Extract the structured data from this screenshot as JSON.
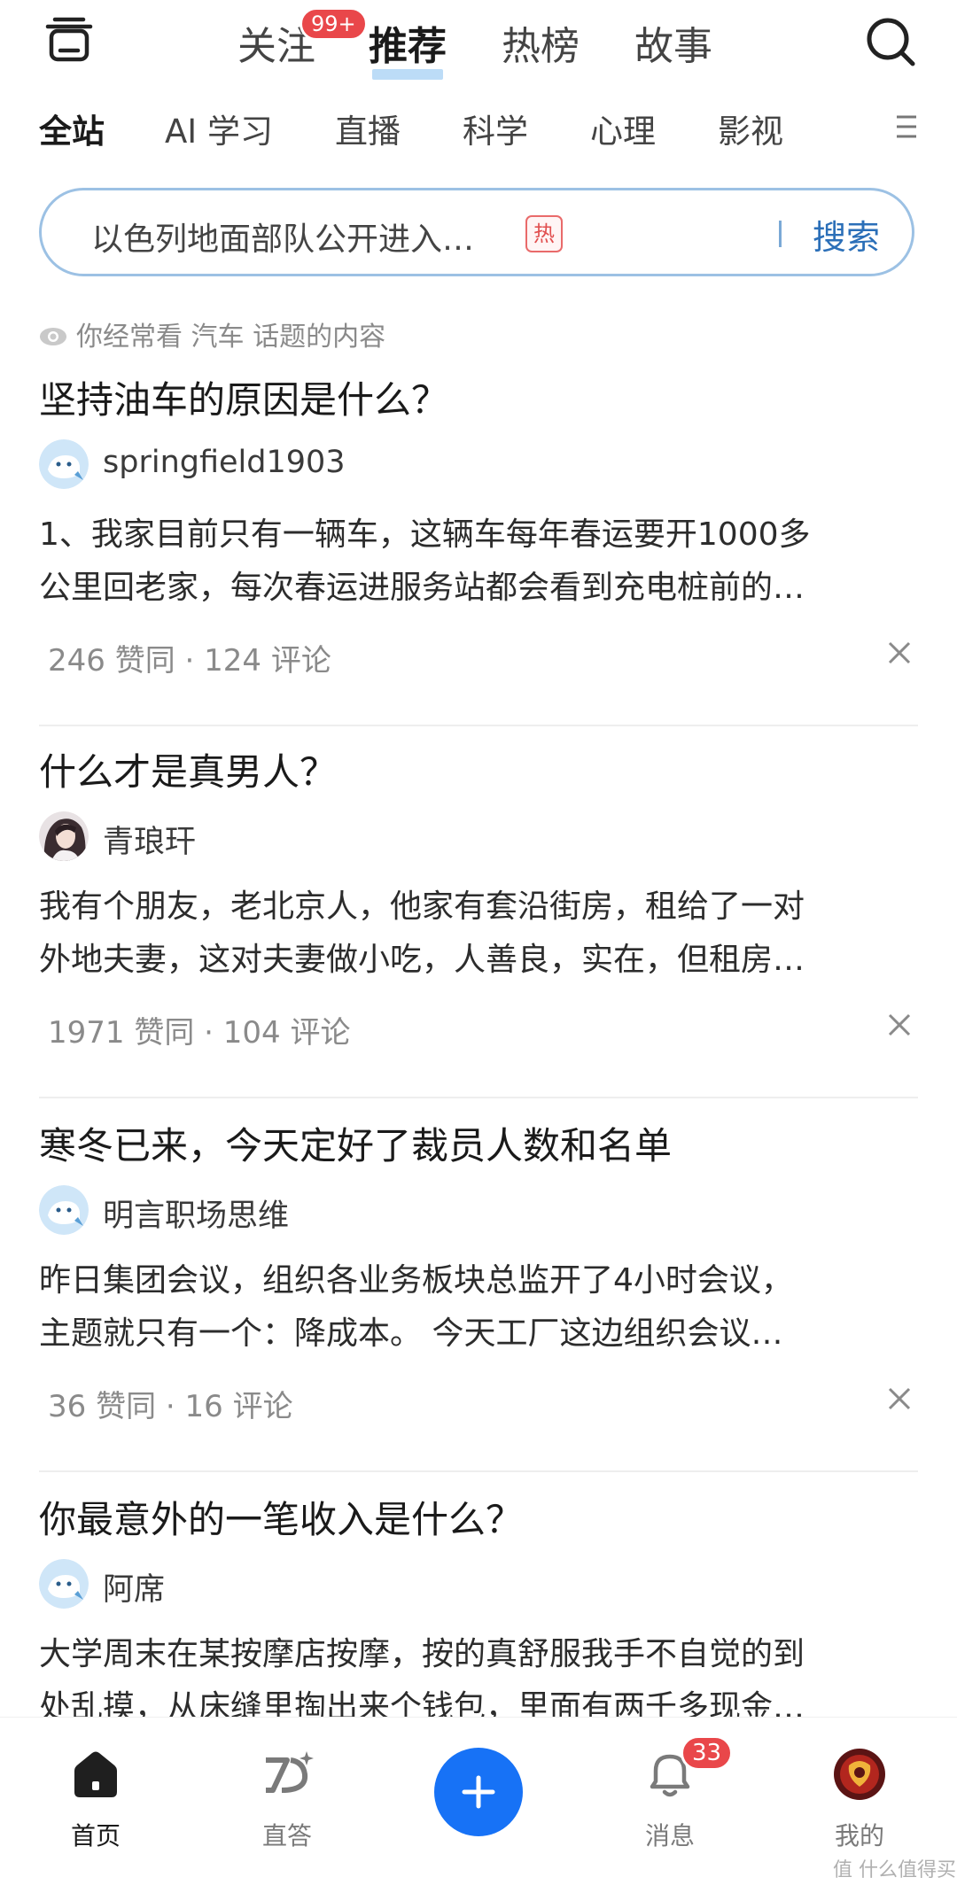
{
  "top_nav": {
    "tabs": [
      {
        "label": "关注",
        "badge": "99+"
      },
      {
        "label": "推荐",
        "active": true
      },
      {
        "label": "热榜"
      },
      {
        "label": "故事"
      }
    ],
    "left_icon": "clipboard-icon",
    "right_icon": "search-icon"
  },
  "categories": {
    "items": [
      "全站",
      "AI 学习",
      "直播",
      "科学",
      "心理",
      "影视"
    ],
    "active": "全站",
    "menu_icon": "menu-icon"
  },
  "search": {
    "query": "以色列地面部队公开进入…",
    "hot_tag": "热",
    "button_label": "搜索"
  },
  "hint": {
    "text": "你经常看 汽车 话题的内容",
    "icon": "eye-icon"
  },
  "feed": [
    {
      "title": "坚持油车的原因是什么？",
      "author": "springfield1903",
      "avatar": "default-avatar",
      "excerpt_lines": [
        "1、我家目前只有一辆车，这辆车每年春运要开1000多",
        "公里回老家，每次春运进服务站都会看到充电桩前的…"
      ],
      "stats": "246 赞同 · 124 评论"
    },
    {
      "title": "什么才是真男人？",
      "author": "青琅玕",
      "avatar": "photo-avatar",
      "excerpt_lines": [
        "我有个朋友，老北京人，他家有套沿街房，租给了一对",
        "外地夫妻，这对夫妻做小吃，人善良，实在，但租房…"
      ],
      "stats": "1971 赞同 · 104 评论"
    },
    {
      "title": "寒冬已来，今天定好了裁员人数和名单",
      "author": "明言职场思维",
      "avatar": "default-avatar",
      "excerpt_lines": [
        "昨日集团会议，组织各业务板块总监开了4小时会议，",
        "主题就只有一个：降成本。 今天工厂这边组织会议…"
      ],
      "stats": "36 赞同 · 16 评论"
    },
    {
      "title": "你最意外的一笔收入是什么？",
      "author": "阿席",
      "avatar": "default-avatar",
      "excerpt_lines": [
        "大学周末在某按摩店按摩，按的真舒服我手不自觉的到",
        "处乱摸，从床缝里掏出来个钱包，里面有两千多现金…"
      ],
      "stats": ""
    }
  ],
  "bottom_nav": {
    "items": [
      {
        "label": "首页",
        "icon": "home-icon",
        "active": true
      },
      {
        "label": "直答",
        "icon": "zhida-icon"
      },
      {
        "label": "",
        "icon": "plus-icon"
      },
      {
        "label": "消息",
        "icon": "bell-icon",
        "badge": "33"
      },
      {
        "label": "我的",
        "icon": "profile-avatar-icon"
      }
    ]
  },
  "watermark": "值 什么值得买",
  "colors": {
    "accent": "#1772f6",
    "badge_red": "#e9474a",
    "search_border": "#9cc1e4",
    "search_button": "#2b6fb8"
  }
}
